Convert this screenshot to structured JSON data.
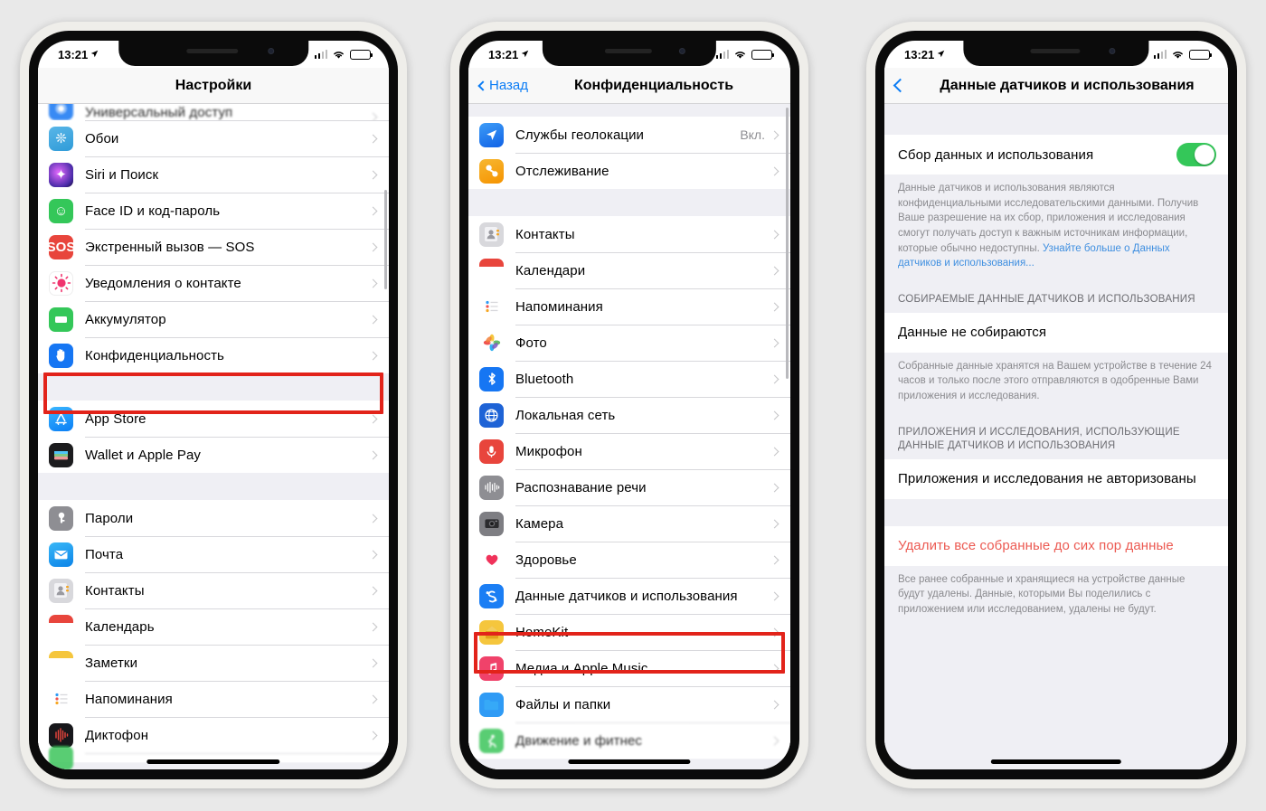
{
  "statusbar": {
    "time": "13:21",
    "location_icon": "location-arrow-icon",
    "cell_icon": "cellular-signal-icon",
    "wifi_icon": "wifi-icon",
    "battery_icon": "battery-icon"
  },
  "phone1": {
    "nav": {
      "title": "Настройки"
    },
    "groups": [
      {
        "rows": [
          {
            "label": "Универсальный доступ",
            "icon": "accessibility-icon",
            "icon_class": "ico-access",
            "glyph": "◉",
            "partial": true
          },
          {
            "label": "Обои",
            "icon": "wallpaper-icon",
            "icon_class": "ico-wallpaper",
            "glyph": "❊"
          },
          {
            "label": "Siri и Поиск",
            "icon": "siri-icon",
            "icon_class": "ico-siri",
            "glyph": "✦"
          },
          {
            "label": "Face ID и код-пароль",
            "icon": "faceid-icon",
            "icon_class": "ico-faceid",
            "glyph": "☺"
          },
          {
            "label": "Экстренный вызов — SOS",
            "icon": "sos-icon",
            "icon_class": "ico-sos",
            "glyph": "SOS"
          },
          {
            "label": "Уведомления о контакте",
            "icon": "contact-notification-icon",
            "icon_class": "ico-contactnotif",
            "glyph": "◉"
          },
          {
            "label": "Аккумулятор",
            "icon": "battery-settings-icon",
            "icon_class": "ico-battery",
            "glyph": "▭"
          },
          {
            "label": "Конфиденциальность",
            "icon": "privacy-hand-icon",
            "icon_class": "ico-privacy",
            "glyph": "✋",
            "highlighted": true
          }
        ]
      },
      {
        "rows": [
          {
            "label": "App Store",
            "icon": "app-store-icon",
            "icon_class": "ico-appstore",
            "glyph": "Ⓐ"
          },
          {
            "label": "Wallet и Apple Pay",
            "icon": "wallet-icon",
            "icon_class": "ico-wallet",
            "glyph": "▤"
          }
        ]
      },
      {
        "rows": [
          {
            "label": "Пароли",
            "icon": "passwords-key-icon",
            "icon_class": "ico-passwords",
            "glyph": "🗝"
          },
          {
            "label": "Почта",
            "icon": "mail-icon",
            "icon_class": "ico-mail",
            "glyph": "✉"
          },
          {
            "label": "Контакты",
            "icon": "contacts-icon",
            "icon_class": "ico-contacts",
            "glyph": "👤"
          },
          {
            "label": "Календарь",
            "icon": "calendar-icon",
            "icon_class": "ico-calendar",
            "glyph": ""
          },
          {
            "label": "Заметки",
            "icon": "notes-icon",
            "icon_class": "ico-notes",
            "glyph": ""
          },
          {
            "label": "Напоминания",
            "icon": "reminders-icon",
            "icon_class": "ico-reminders",
            "glyph": ""
          },
          {
            "label": "Диктофон",
            "icon": "voice-memos-icon",
            "icon_class": "ico-voice",
            "glyph": "|||"
          }
        ]
      }
    ]
  },
  "phone2": {
    "nav": {
      "back_label": "Назад",
      "title": "Конфиденциальность"
    },
    "groups": [
      {
        "rows": [
          {
            "label": "Службы геолокации",
            "value": "Вкл.",
            "icon": "location-services-icon",
            "icon_class": "ico-location",
            "glyph": "➤"
          },
          {
            "label": "Отслеживание",
            "icon": "tracking-icon",
            "icon_class": "ico-tracking",
            "glyph": "⬤"
          }
        ]
      },
      {
        "rows": [
          {
            "label": "Контакты",
            "icon": "contacts-icon",
            "icon_class": "ico-contacts",
            "glyph": "👤"
          },
          {
            "label": "Календари",
            "icon": "calendar-icon",
            "icon_class": "ico-calendar",
            "glyph": ""
          },
          {
            "label": "Напоминания",
            "icon": "reminders-icon",
            "icon_class": "ico-reminders",
            "glyph": ""
          },
          {
            "label": "Фото",
            "icon": "photos-icon",
            "icon_class": "ico-photos",
            "glyph": "✿"
          },
          {
            "label": "Bluetooth",
            "icon": "bluetooth-icon",
            "icon_class": "ico-bt",
            "glyph": "✲"
          },
          {
            "label": "Локальная сеть",
            "icon": "local-network-icon",
            "icon_class": "ico-lan",
            "glyph": "◍"
          },
          {
            "label": "Микрофон",
            "icon": "microphone-icon",
            "icon_class": "ico-mic",
            "glyph": "🎤"
          },
          {
            "label": "Распознавание речи",
            "icon": "speech-recognition-icon",
            "icon_class": "ico-speech",
            "glyph": "|||"
          },
          {
            "label": "Камера",
            "icon": "camera-icon",
            "icon_class": "ico-camera",
            "glyph": "📷"
          },
          {
            "label": "Здоровье",
            "icon": "health-icon",
            "icon_class": "ico-health",
            "glyph": "♥"
          },
          {
            "label": "Данные датчиков и использования",
            "icon": "sensor-usage-data-icon",
            "icon_class": "ico-sensor",
            "glyph": "§",
            "highlighted": true
          },
          {
            "label": "HomeKit",
            "icon": "homekit-icon",
            "icon_class": "ico-homekit",
            "glyph": "⌂"
          },
          {
            "label": "Медиа и Apple Music",
            "icon": "apple-music-icon",
            "icon_class": "ico-music",
            "glyph": "♫"
          },
          {
            "label": "Файлы и папки",
            "icon": "files-icon",
            "icon_class": "ico-files",
            "glyph": "▰"
          },
          {
            "label": "Движение и фитнес",
            "icon": "motion-fitness-icon",
            "icon_class": "ico-fitness",
            "glyph": "🏃",
            "partial": true
          }
        ]
      }
    ]
  },
  "phone3": {
    "nav": {
      "title": "Данные датчиков и использования",
      "back_icon": "back-chevron-icon"
    },
    "toggle_row": {
      "label": "Сбор данных и использования",
      "enabled": true
    },
    "footer1_text": "Данные датчиков и использования являются конфиденциальными исследовательскими данными. Получив Ваше разрешение на их сбор, приложения и исследования смогут получать доступ к важным источникам информации, которые обычно недоступны. ",
    "footer1_link": "Узнайте больше о Данных датчиков и использования...",
    "section2_header": "СОБИРАЕМЫЕ ДАННЫЕ ДАТЧИКОВ И ИСПОЛЬЗОВАНИЯ",
    "section2_row": "Данные не собираются",
    "footer2_text": "Собранные данные хранятся на Вашем устройстве в течение 24 часов и только после этого отправляются в одобренные Вами приложения и исследования.",
    "section3_header": "ПРИЛОЖЕНИЯ И ИССЛЕДОВАНИЯ, ИСПОЛЬЗУЮЩИЕ ДАННЫЕ ДАТЧИКОВ И ИСПОЛЬЗОВАНИЯ",
    "section3_row": "Приложения и исследования не авторизованы",
    "delete_row": "Удалить все собранные до сих пор данные",
    "footer3_text": "Все ранее собранные и хранящиеся на устройстве данные будут удалены. Данные, которыми Вы поделились с приложением или исследованием, удалены не будут."
  },
  "colors": {
    "highlight": "#e2231a",
    "accent_blue": "#0a7cf5",
    "toggle_green": "#34c759",
    "destructive": "#ec5a52"
  }
}
